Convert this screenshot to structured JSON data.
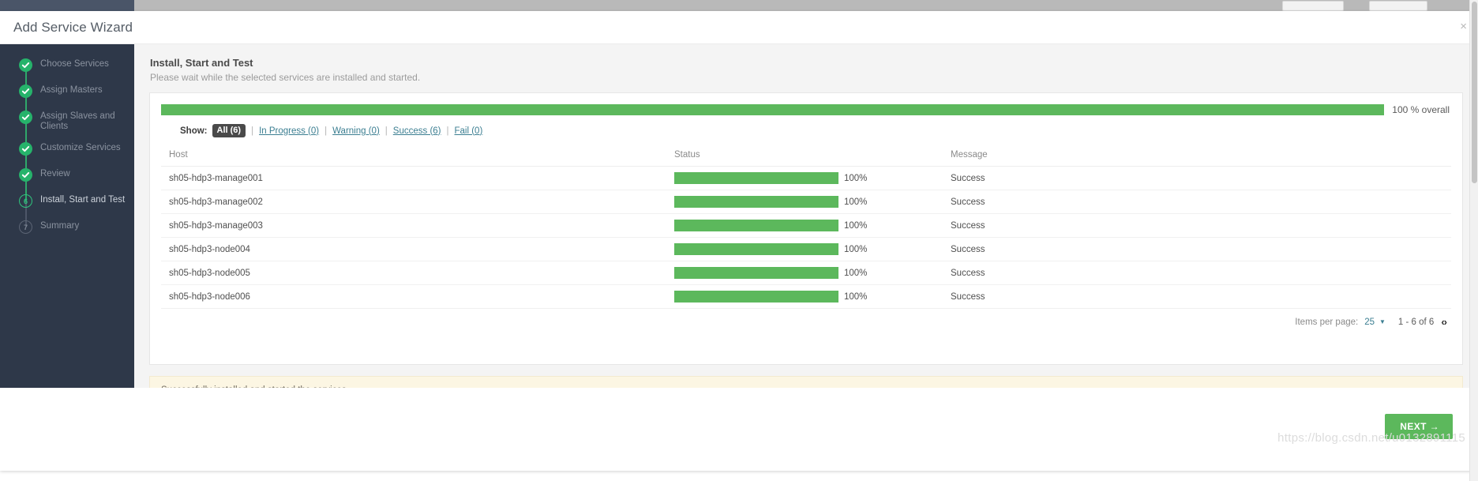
{
  "window": {
    "title": "Add Service Wizard",
    "close_label": "×"
  },
  "sidebar": {
    "steps": [
      {
        "label": "Choose Services",
        "state": "done",
        "marker": "✓"
      },
      {
        "label": "Assign Masters",
        "state": "done",
        "marker": "✓"
      },
      {
        "label": "Assign Slaves and Clients",
        "state": "done",
        "marker": "✓"
      },
      {
        "label": "Customize Services",
        "state": "done",
        "marker": "✓"
      },
      {
        "label": "Review",
        "state": "done",
        "marker": "✓"
      },
      {
        "label": "Install, Start and Test",
        "state": "active",
        "marker": "6"
      },
      {
        "label": "Summary",
        "state": "todo",
        "marker": "7"
      }
    ]
  },
  "main": {
    "title": "Install, Start and Test",
    "subtitle": "Please wait while the selected services are installed and started.",
    "overall": {
      "percent": 100,
      "label": "100 % overall"
    },
    "filter": {
      "show_label": "Show:",
      "separator": "|",
      "options": [
        {
          "label": "All (6)",
          "selected": true
        },
        {
          "label": "In Progress (0)",
          "selected": false
        },
        {
          "label": "Warning (0)",
          "selected": false
        },
        {
          "label": "Success (6)",
          "selected": false
        },
        {
          "label": "Fail (0)",
          "selected": false
        }
      ]
    },
    "table": {
      "columns": [
        "Host",
        "Status",
        "Message"
      ],
      "rows": [
        {
          "host": "sh05-hdp3-manage001",
          "percent": 100,
          "percent_label": "100%",
          "message": "Success"
        },
        {
          "host": "sh05-hdp3-manage002",
          "percent": 100,
          "percent_label": "100%",
          "message": "Success"
        },
        {
          "host": "sh05-hdp3-manage003",
          "percent": 100,
          "percent_label": "100%",
          "message": "Success"
        },
        {
          "host": "sh05-hdp3-node004",
          "percent": 100,
          "percent_label": "100%",
          "message": "Success"
        },
        {
          "host": "sh05-hdp3-node005",
          "percent": 100,
          "percent_label": "100%",
          "message": "Success"
        },
        {
          "host": "sh05-hdp3-node006",
          "percent": 100,
          "percent_label": "100%",
          "message": "Success"
        }
      ]
    },
    "paginator": {
      "items_per_page_label": "Items per page:",
      "items_per_page_value": "25",
      "caret": "▼",
      "range": "1 - 6 of 6",
      "prev": "‹",
      "next": "›"
    },
    "alert": {
      "text": "Successfully installed and started the services."
    }
  },
  "footer": {
    "next_label": "NEXT  →",
    "watermark": "https://blog.csdn.net/u0132891115"
  },
  "colors": {
    "accent_green": "#5cb85c",
    "sidebar_bg": "#2e3849",
    "link": "#3b7e91",
    "alert_bg": "#fcf6e3"
  }
}
